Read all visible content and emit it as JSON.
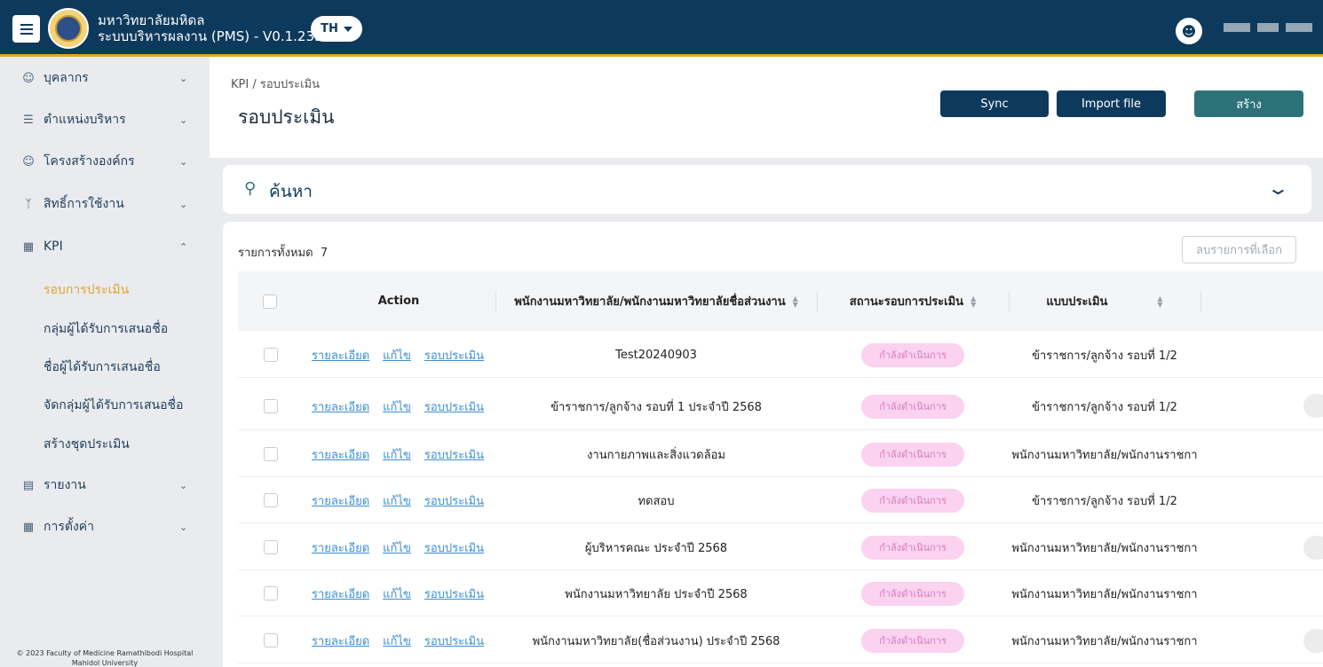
{
  "header": {
    "title_line1": "มหาวิทยาลัยมหิดล",
    "title_line2": "ระบบบริหารผลงาน (PMS) - V0.1.233",
    "lang": "TH",
    "color_primary": "#0d3a5c",
    "color_accent": "#e1a52d"
  },
  "sidebar": {
    "items": [
      {
        "label": "บุคลากร",
        "icon": "person-icon"
      },
      {
        "label": "ตำแหน่งบริหาร",
        "icon": "list-icon"
      },
      {
        "label": "โครงสร้างองค์กร",
        "icon": "person-icon"
      },
      {
        "label": "สิทธิ์การใช้งาน",
        "icon": "branch-icon"
      },
      {
        "label": "KPI",
        "icon": "grid-icon"
      },
      {
        "label": "รายงาน",
        "icon": "document-icon"
      },
      {
        "label": "การตั้งค่า",
        "icon": "calculator-icon"
      }
    ],
    "kpi_sub": [
      "รอบการประเมิน",
      "กลุ่มผู้ได้รับการเสนอชื่อ",
      "ชื่อผู้ได้รับการเสนอชื่อ",
      "จัดกลุ่มผู้ได้รับการเสนอชื่อ",
      "สร้างชุดประเมิน"
    ],
    "footer_line1": "© 2023 Faculty of Medicine Ramathibodi Hospital",
    "footer_line2": "Mahidol University"
  },
  "main": {
    "breadcrumb": "KPI  /  รอบประเมิน",
    "title": "รอบประเมิน",
    "btn_sync": "Sync",
    "btn_import": "Import file",
    "btn_create": "สร้าง",
    "search_label": "ค้นหา"
  },
  "table": {
    "total_label": "รายการทั้งหมด",
    "total_count": "7",
    "delete_selected": "ลบรายการที่เลือก",
    "headers": {
      "action": "Action",
      "name": "พนักงานมหาวิทยาลัย/พนักงานมหาวิทยาลัยชื่อส่วนงาน",
      "status": "สถานะรอบการประเมิน",
      "form": "แบบประเมิน"
    },
    "action_links": {
      "detail": "รายละเอียด",
      "edit": "แก้ไข",
      "round": "รอบประเมิน"
    },
    "rows": [
      {
        "name": "Test20240903",
        "status": "กำลังดำเนินการ",
        "form": "ข้าราชการ/ลูกจ้าง รอบที่ 1/2"
      },
      {
        "name": "ข้าราชการ/ลูกจ้าง รอบที่ 1 ประจำปี 2568",
        "status": "กำลังดำเนินการ",
        "form": "ข้าราชการ/ลูกจ้าง รอบที่ 1/2"
      },
      {
        "name": "งานกายภาพและสิ่งแวดล้อม",
        "status": "กำลังดำเนินการ",
        "form": "พนักงานมหาวิทยาลัย/พนักงานราชกา"
      },
      {
        "name": "ทดสอบ",
        "status": "กำลังดำเนินการ",
        "form": "ข้าราชการ/ลูกจ้าง รอบที่ 1/2"
      },
      {
        "name": "ผู้บริหารคณะ ประจำปี 2568",
        "status": "กำลังดำเนินการ",
        "form": "พนักงานมหาวิทยาลัย/พนักงานราชกา"
      },
      {
        "name": "พนักงานมหาวิทยาลัย ประจำปี 2568",
        "status": "กำลังดำเนินการ",
        "form": "พนักงานมหาวิทยาลัย/พนักงานราชกา"
      },
      {
        "name": "พนักงานมหาวิทยาลัย(ชื่อส่วนงาน) ประจำปี 2568",
        "status": "กำลังดำเนินการ",
        "form": "พนักงานมหาวิทยาลัย/พนักงานราชกา"
      }
    ]
  }
}
